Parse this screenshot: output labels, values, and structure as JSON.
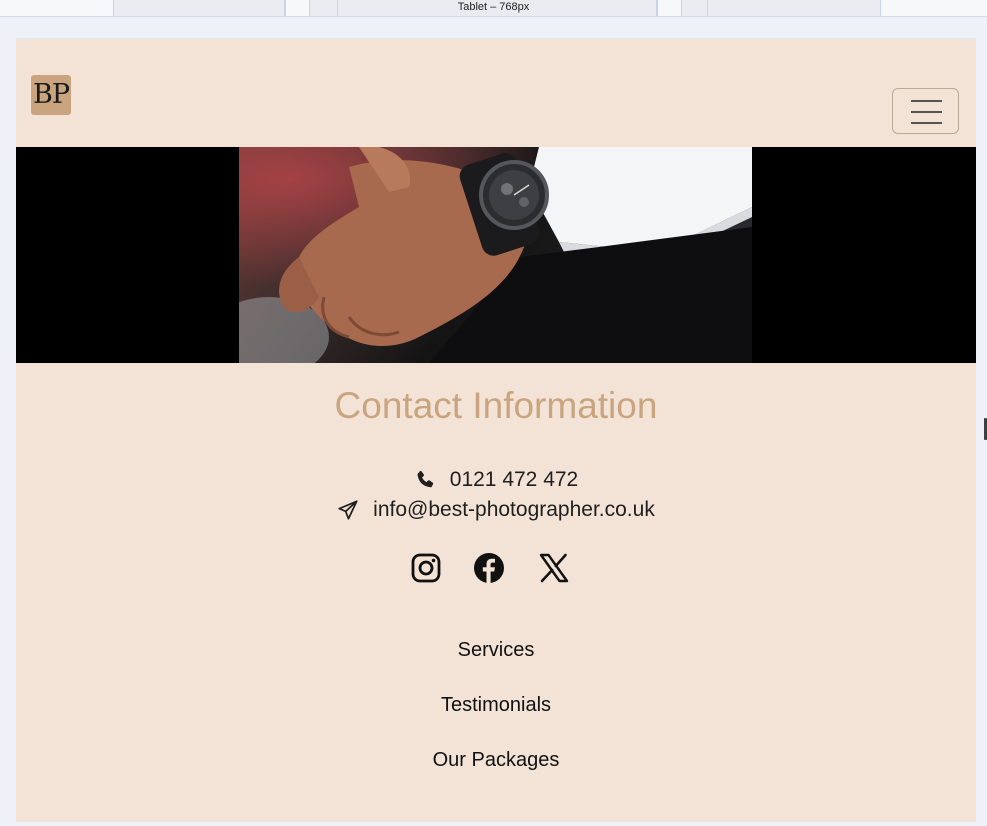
{
  "devtools": {
    "ruler_label": "Tablet – 768px"
  },
  "navbar": {
    "logo_text": "BP",
    "toggle_icon": "hamburger-icon"
  },
  "hero": {
    "image_description_icon": "wrist-watch-photo"
  },
  "contact": {
    "heading": "Contact Information",
    "phone": "0121 472 472",
    "email": "info@best-photographer.co.uk",
    "phone_icon": "phone-icon",
    "email_icon": "paper-plane-icon"
  },
  "social": [
    "instagram-icon",
    "facebook-icon",
    "x-icon"
  ],
  "footer_links": [
    "Services",
    "Testimonials",
    "Our Packages"
  ],
  "colors": {
    "page_bg": "#f3e3d6",
    "accent": "#c9a47f",
    "text": "#1f1f1f"
  }
}
